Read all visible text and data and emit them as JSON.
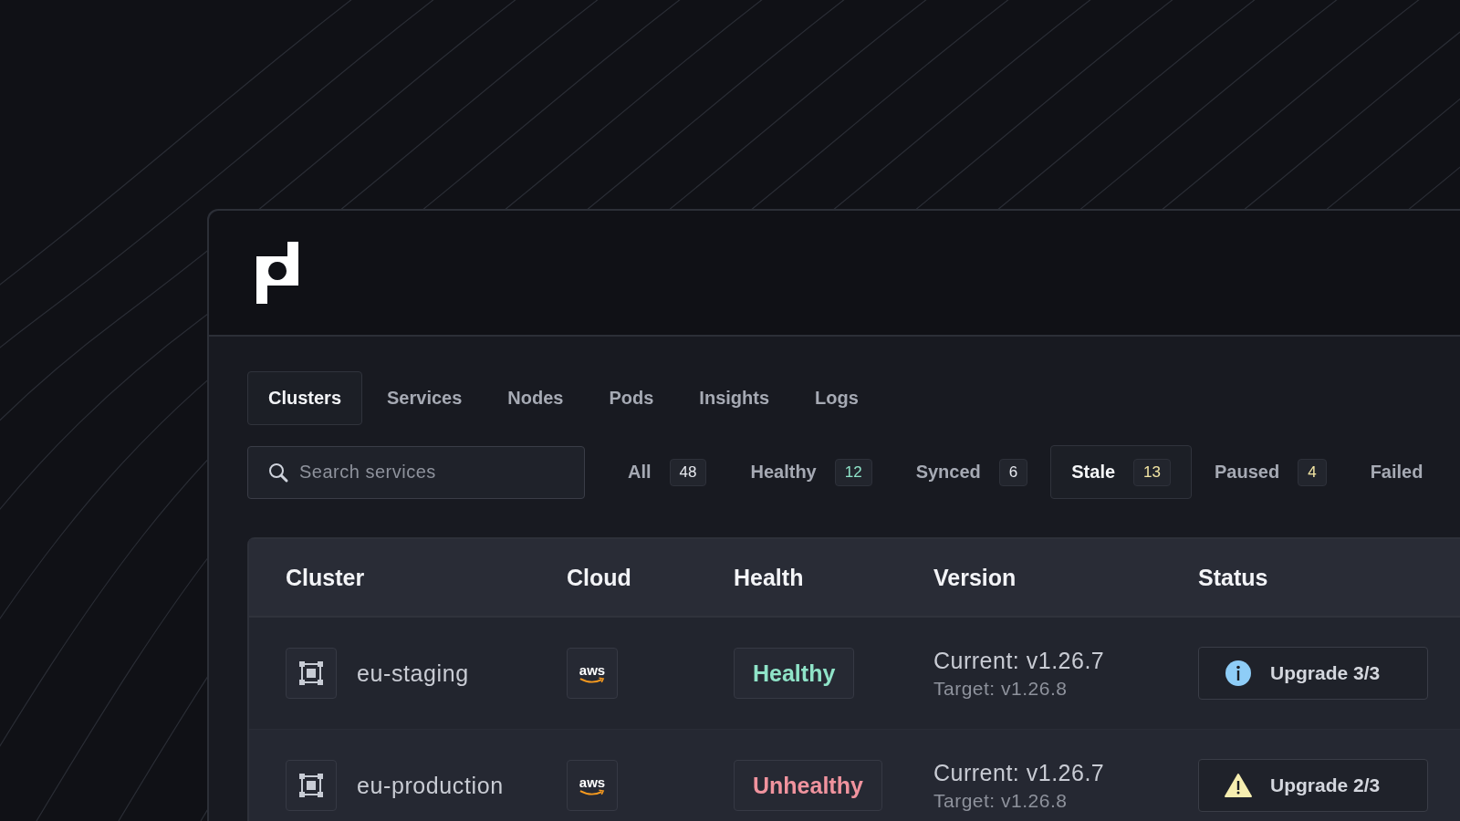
{
  "tabs": [
    {
      "label": "Clusters",
      "selected": true
    },
    {
      "label": "Services",
      "selected": false
    },
    {
      "label": "Nodes",
      "selected": false
    },
    {
      "label": "Pods",
      "selected": false
    },
    {
      "label": "Insights",
      "selected": false
    },
    {
      "label": "Logs",
      "selected": false
    }
  ],
  "search": {
    "placeholder": "Search services"
  },
  "filters": [
    {
      "label": "All",
      "count": "48",
      "color": "#e6e8ee",
      "selected": false
    },
    {
      "label": "Healthy",
      "count": "12",
      "color": "#8fe3c8",
      "selected": false
    },
    {
      "label": "Synced",
      "count": "6",
      "color": "#e6e8ee",
      "selected": false
    },
    {
      "label": "Stale",
      "count": "13",
      "color": "#f3e6a4",
      "selected": true
    },
    {
      "label": "Paused",
      "count": "4",
      "color": "#f3e6a4",
      "selected": false
    },
    {
      "label": "Failed",
      "selected": false
    }
  ],
  "table": {
    "columns": [
      "Cluster",
      "Cloud",
      "Health",
      "Version",
      "Status"
    ],
    "rows": [
      {
        "cluster": "eu-staging",
        "cloud": "aws",
        "health": "Healthy",
        "color": "#8fe3c8",
        "current": "Current: v1.26.7",
        "target": "Target: v1.26.8",
        "status": {
          "kind": "info",
          "label": "Upgrade 3/3"
        }
      },
      {
        "cluster": "eu-production",
        "cloud": "aws",
        "health": "Unhealthy",
        "color": "#f0939e",
        "current": "Current: v1.26.7",
        "target": "Target: v1.26.8",
        "status": {
          "kind": "warning",
          "label": "Upgrade 2/3"
        }
      }
    ]
  }
}
